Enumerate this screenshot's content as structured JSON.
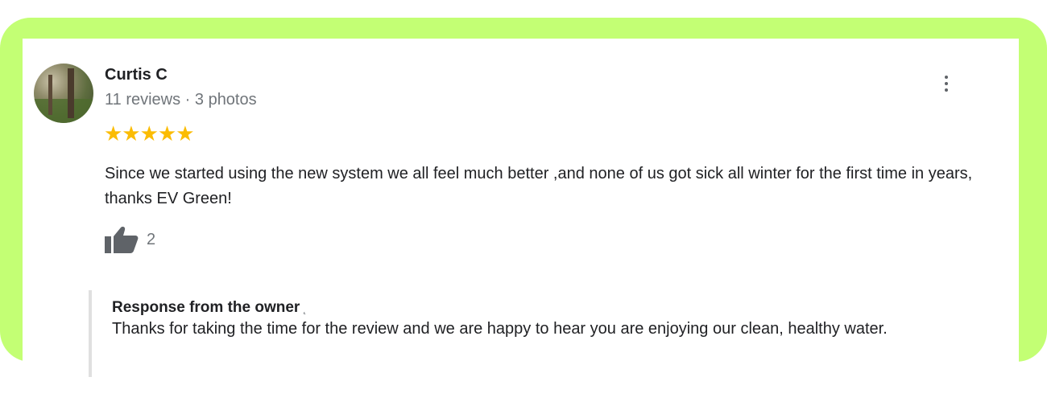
{
  "review": {
    "author": "Curtis C",
    "meta": "11 reviews · 3 photos",
    "rating_stars": "★★★★★",
    "rating": 5,
    "text": "Since we started using the new system we all feel much better ,and none of us got sick all winter for the first time in years, thanks EV Green!",
    "likes": "2"
  },
  "owner_response": {
    "title": "Response from the owner",
    "suffix": "˛",
    "text": "Thanks for taking the time for the review and we are happy to hear you are enjoying our clean, healthy water."
  },
  "colors": {
    "frame": "#c3ff74",
    "star": "#fbbc04",
    "text": "#202124",
    "muted": "#70757a"
  },
  "icons": {
    "more": "more-vert-icon",
    "like": "thumb-up-icon"
  }
}
